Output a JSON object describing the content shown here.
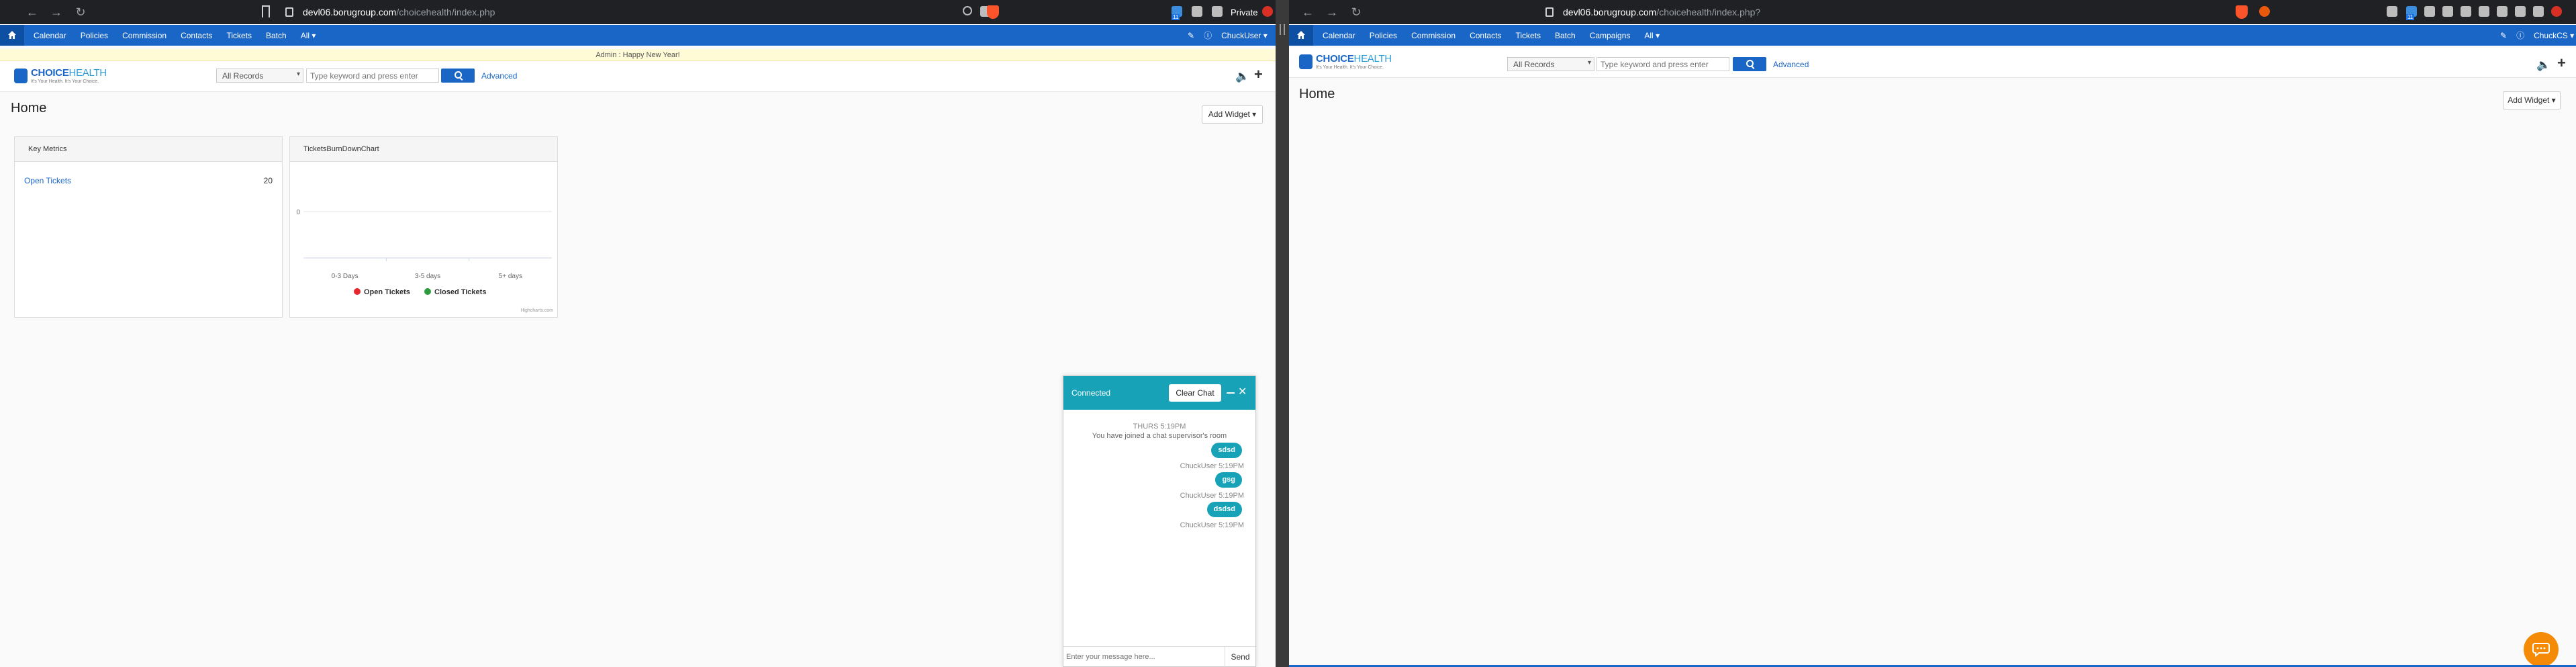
{
  "left": {
    "browser": {
      "url_host": "devl06.borugroup.com",
      "url_path": "/choicehealth/index.php",
      "private_label": "Private",
      "tab_count": "11"
    },
    "nav": {
      "items": [
        "Calendar",
        "Policies",
        "Commission",
        "Contacts",
        "Tickets",
        "Batch",
        "All"
      ],
      "user": "ChuckUser"
    },
    "announcement": "Admin : Happy New Year!",
    "header": {
      "logo_name": "CHOICE",
      "logo_name2": "HEALTH",
      "logo_tagline": "It's Your Health. It's Your Choice.",
      "record_select": "All Records",
      "search_placeholder": "Type keyword and press enter",
      "advanced": "Advanced"
    },
    "page_title": "Home",
    "add_widget": "Add Widget",
    "key_metrics": {
      "title": "Key Metrics",
      "row_label": "Open Tickets",
      "row_value": "20"
    },
    "burn_chart": {
      "title": "TicketsBurnDownChart",
      "credits": "Highcharts.com"
    },
    "chat": {
      "status": "Connected",
      "clear_label": "Clear Chat",
      "timestamp": "THURS 5:19PM",
      "system_msg": "You have joined a chat supervisor's room",
      "messages": [
        {
          "text": "sdsd",
          "meta": "ChuckUser 5:19PM"
        },
        {
          "text": "gsg",
          "meta": "ChuckUser 5:19PM"
        },
        {
          "text": "dsdsd",
          "meta": "ChuckUser 5:19PM"
        }
      ],
      "input_placeholder": "Enter your message here...",
      "send_label": "Send"
    }
  },
  "right": {
    "browser": {
      "url_host": "devl06.borugroup.com",
      "url_path": "/choicehealth/index.php?",
      "tab_count": "11"
    },
    "nav": {
      "items": [
        "Calendar",
        "Policies",
        "Commission",
        "Contacts",
        "Tickets",
        "Batch",
        "Campaigns",
        "All"
      ],
      "user": "ChuckCS"
    },
    "header": {
      "record_select": "All Records",
      "search_placeholder": "Type keyword and press enter",
      "advanced": "Advanced"
    },
    "page_title": "Home",
    "add_widget": "Add Widget"
  },
  "chart_data": {
    "type": "bar",
    "categories": [
      "0-3 Days",
      "3-5 days",
      "5+ days"
    ],
    "series": [
      {
        "name": "Open Tickets",
        "values": [
          0,
          0,
          0
        ],
        "color": "#e8262d"
      },
      {
        "name": "Closed Tickets",
        "values": [
          0,
          0,
          0
        ],
        "color": "#2e9b3e"
      }
    ],
    "y_ticks": [
      "0"
    ],
    "title": "",
    "legend": "bottom"
  },
  "colors": {
    "nav_blue": "#1a66c7",
    "chat_teal": "#17a2b8",
    "fab_orange": "#f58a07"
  }
}
